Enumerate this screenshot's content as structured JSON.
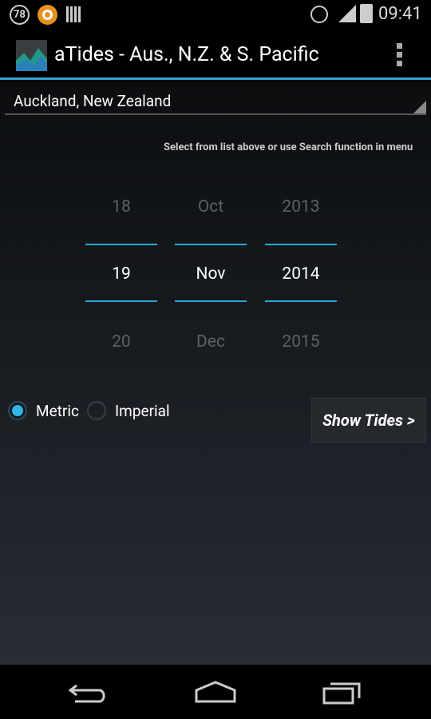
{
  "status_bar": {
    "notification_badge": "78",
    "time": "09:41",
    "icons": [
      "notification-count-icon",
      "app-notification-icon",
      "barcode-icon",
      "alarm-icon",
      "signal-icon",
      "battery-charging-icon"
    ]
  },
  "action_bar": {
    "title": "aTides - Aus., N.Z. & S. Pacific",
    "icon": "app-logo-icon",
    "overflow": "overflow-menu-icon"
  },
  "location_spinner": {
    "value": "Auckland, New Zealand"
  },
  "hint": "Select from list above or use Search function in menu",
  "date_picker": {
    "day": {
      "prev": "18",
      "selected": "19",
      "next": "20"
    },
    "month": {
      "prev": "Oct",
      "selected": "Nov",
      "next": "Dec"
    },
    "year": {
      "prev": "2013",
      "selected": "2014",
      "next": "2015"
    }
  },
  "units": {
    "options": [
      {
        "label": "Metric",
        "checked": true
      },
      {
        "label": "Imperial",
        "checked": false
      }
    ]
  },
  "show_tides_label": "Show Tides >",
  "colors": {
    "accent": "#33a4d4"
  }
}
